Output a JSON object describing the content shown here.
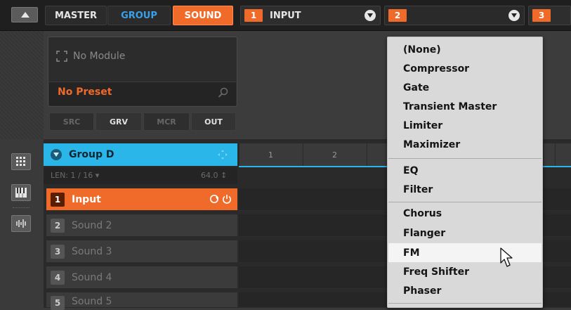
{
  "header": {
    "tabs": [
      {
        "label": "MASTER"
      },
      {
        "label": "GROUP"
      },
      {
        "label": "SOUND"
      }
    ],
    "slots": [
      {
        "number": "1",
        "label": "INPUT"
      },
      {
        "number": "2",
        "label": ""
      },
      {
        "number": "3",
        "label": ""
      }
    ]
  },
  "module": {
    "title": "No Module",
    "preset": "No Preset",
    "subtabs": [
      "SRC",
      "GRV",
      "MCR",
      "OUT"
    ]
  },
  "group": {
    "label": "Group D",
    "length": "LEN: 1 / 16",
    "tempo": "64.0"
  },
  "sounds": [
    {
      "number": "1",
      "name": "Input"
    },
    {
      "number": "2",
      "name": "Sound 2"
    },
    {
      "number": "3",
      "name": "Sound 3"
    },
    {
      "number": "4",
      "name": "Sound 4"
    },
    {
      "number": "5",
      "name": "Sound 5"
    }
  ],
  "timeline": {
    "markers": [
      "1",
      "2"
    ]
  },
  "menu": {
    "items": [
      "(None)",
      "Compressor",
      "Gate",
      "Transient Master",
      "Limiter",
      "Maximizer",
      "EQ",
      "Filter",
      "Chorus",
      "Flanger",
      "FM",
      "Freq Shifter",
      "Phaser"
    ],
    "highlighted": "FM"
  },
  "colors": {
    "accent_orange": "#f06a2a",
    "accent_blue": "#2bb6ea",
    "menu_bg": "#d9d9d9"
  }
}
